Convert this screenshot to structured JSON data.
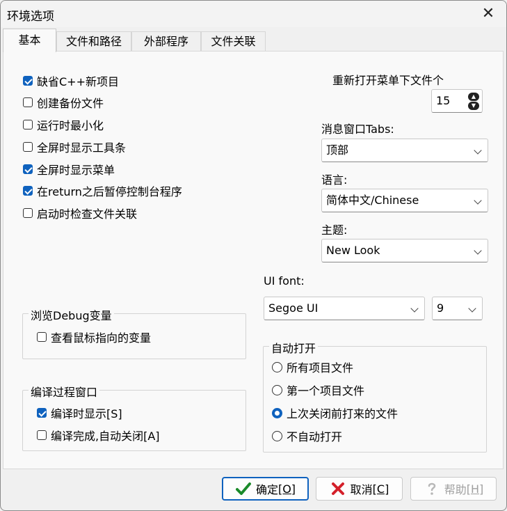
{
  "window": {
    "title": "环境选项",
    "close_glyph": "✕"
  },
  "tabs": [
    {
      "label": "基本",
      "active": true
    },
    {
      "label": "文件和路径",
      "active": false
    },
    {
      "label": "外部程序",
      "active": false
    },
    {
      "label": "文件关联",
      "active": false
    }
  ],
  "general": {
    "checkboxes": [
      {
        "label": "缺省C++新项目",
        "checked": true
      },
      {
        "label": "创建备份文件",
        "checked": false
      },
      {
        "label": "运行时最小化",
        "checked": false
      },
      {
        "label": "全屏时显示工具条",
        "checked": false
      },
      {
        "label": "全屏时显示菜单",
        "checked": true
      },
      {
        "label": "在return之后暂停控制台程序",
        "checked": true
      },
      {
        "label": "启动时检查文件关联",
        "checked": false
      }
    ]
  },
  "reopen": {
    "label": "重新打开菜单下文件个",
    "value": "15"
  },
  "message_tabs": {
    "label": "消息窗口Tabs:",
    "value": "顶部"
  },
  "language": {
    "label": "语言:",
    "value": "简体中文/Chinese"
  },
  "theme": {
    "label": "主题:",
    "value": "New Look"
  },
  "ui_font": {
    "label": "UI font:",
    "font_value": "Segoe UI",
    "size_value": "9"
  },
  "debug_group": {
    "title": "浏览Debug变量",
    "checkbox": {
      "label": "查看鼠标指向的变量",
      "checked": false
    }
  },
  "compile_group": {
    "title": "编译过程窗口",
    "checkboxes": [
      {
        "label": "编译时显示[S]",
        "checked": true
      },
      {
        "label": "编译完成,自动关闭[A]",
        "checked": false
      }
    ]
  },
  "autoopen_group": {
    "title": "自动打开",
    "options": [
      {
        "label": "所有项目文件",
        "selected": false
      },
      {
        "label": "第一个项目文件",
        "selected": false
      },
      {
        "label": "上次关闭前打来的文件",
        "selected": true
      },
      {
        "label": "不自动打开",
        "selected": false
      }
    ]
  },
  "buttons": {
    "ok": {
      "text": "确定",
      "hotkey": "[O]",
      "icon": "checkmark-icon",
      "color": "#1a8a2a"
    },
    "cancel": {
      "text": "取消",
      "hotkey": "[C]",
      "icon": "red-x-icon",
      "color": "#d4202a"
    },
    "help": {
      "text": "帮助",
      "hotkey": "[H]",
      "icon": "question-icon"
    }
  },
  "colors": {
    "accent": "#0f62be",
    "panel": "#f9f9f9",
    "window": "#f0f0f0"
  }
}
